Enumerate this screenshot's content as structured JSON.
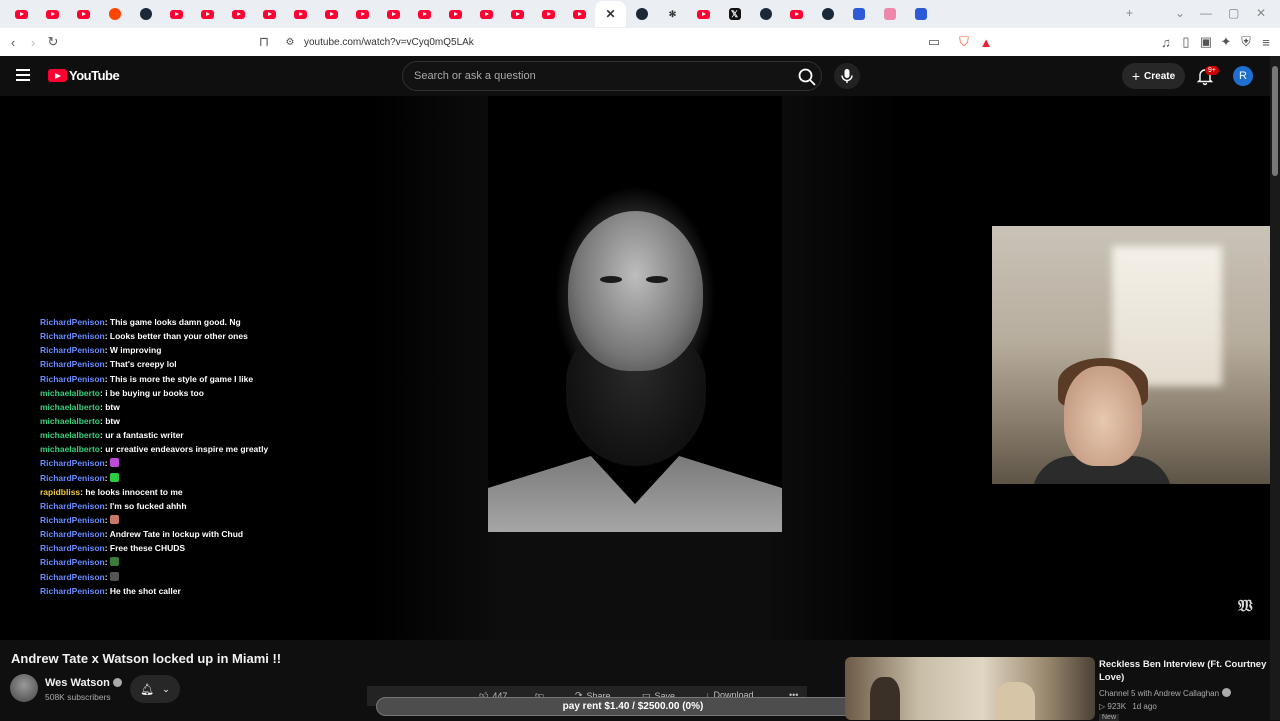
{
  "browser": {
    "tabs": [
      {
        "icon": "youtube-icon"
      },
      {
        "icon": "youtube-icon"
      },
      {
        "icon": "youtube-icon"
      },
      {
        "icon": "reddit-icon"
      },
      {
        "icon": "steam-icon"
      },
      {
        "icon": "youtube-icon"
      },
      {
        "icon": "youtube-icon"
      },
      {
        "icon": "youtube-icon"
      },
      {
        "icon": "youtube-icon"
      },
      {
        "icon": "youtube-icon"
      },
      {
        "icon": "youtube-icon"
      },
      {
        "icon": "youtube-icon"
      },
      {
        "icon": "youtube-icon"
      },
      {
        "icon": "youtube-icon"
      },
      {
        "icon": "youtube-icon"
      },
      {
        "icon": "youtube-icon"
      },
      {
        "icon": "youtube-icon"
      },
      {
        "icon": "youtube-icon"
      },
      {
        "icon": "youtube-icon"
      },
      {
        "icon": "close-icon",
        "active": true
      },
      {
        "icon": "steam-icon"
      },
      {
        "icon": "ai-icon"
      },
      {
        "icon": "youtube-icon"
      },
      {
        "icon": "x-icon"
      },
      {
        "icon": "steam-icon"
      },
      {
        "icon": "youtube-icon"
      },
      {
        "icon": "steam-icon"
      },
      {
        "icon": "app-icon"
      },
      {
        "icon": "extension-icon"
      },
      {
        "icon": "app-icon"
      }
    ],
    "url": "youtube.com/watch?v=vCyq0mQ5LAk"
  },
  "youtube": {
    "logo_text": "YouTube",
    "search_placeholder": "Search or ask a question",
    "create_label": "Create",
    "notification_badge": "9+",
    "avatar_letter": "R"
  },
  "chat": [
    {
      "user": "RichardPenison",
      "color": "#6b8cff",
      "text": "This game looks damn good. Ng"
    },
    {
      "user": "RichardPenison",
      "color": "#6b8cff",
      "text": "Looks better than your other ones"
    },
    {
      "user": "RichardPenison",
      "color": "#6b8cff",
      "text": "W improving"
    },
    {
      "user": "RichardPenison",
      "color": "#6b8cff",
      "text": "That's creepy lol"
    },
    {
      "user": "RichardPenison",
      "color": "#6b8cff",
      "text": "This is more the style of game I like"
    },
    {
      "user": "michaelalberto",
      "color": "#35d07f",
      "text": "i be buying ur books too"
    },
    {
      "user": "michaelalberto",
      "color": "#35d07f",
      "text": "btw"
    },
    {
      "user": "michaelalberto",
      "color": "#35d07f",
      "text": "btw"
    },
    {
      "user": "michaelalberto",
      "color": "#35d07f",
      "text": "ur a fantastic writer"
    },
    {
      "user": "michaelalberto",
      "color": "#35d07f",
      "text": "ur creative endeavors inspire me greatly"
    },
    {
      "user": "RichardPenison",
      "color": "#6b8cff",
      "text": "",
      "emoji": "#c04bd8"
    },
    {
      "user": "RichardPenison",
      "color": "#6b8cff",
      "text": "",
      "emoji": "#2ecc40"
    },
    {
      "user": "rapidbliss",
      "color": "#f2c94c",
      "text": "he looks innocent to me"
    },
    {
      "user": "RichardPenison",
      "color": "#6b8cff",
      "text": "I'm so fucked ahhh"
    },
    {
      "user": "RichardPenison",
      "color": "#6b8cff",
      "text": "",
      "emoji": "#c77a6a"
    },
    {
      "user": "RichardPenison",
      "color": "#6b8cff",
      "text": "Andrew Tate in lockup with Chud"
    },
    {
      "user": "RichardPenison",
      "color": "#6b8cff",
      "text": "Free these CHUDS"
    },
    {
      "user": "RichardPenison",
      "color": "#6b8cff",
      "text": "",
      "emoji": "#3a7d3a"
    },
    {
      "user": "RichardPenison",
      "color": "#6b8cff",
      "text": "",
      "emoji": "#555555"
    },
    {
      "user": "RichardPenison",
      "color": "#6b8cff",
      "text": "He the shot caller"
    }
  ],
  "video": {
    "title": "Andrew Tate x Watson locked up in Miami !!",
    "channel": "Wes Watson",
    "subscribers": "508K subscribers",
    "likes": "447",
    "share_label": "Share",
    "save_label": "Save",
    "download_label": "Download",
    "overlay_banner": "pay rent $1.40 / $2500.00 (0%)"
  },
  "recommendation": {
    "title": "Reckless Ben Interview (Ft. Courtney Love)",
    "channel": "Channel 5 with Andrew Callaghan",
    "views": "923K",
    "age": "1d ago",
    "badge": "New"
  }
}
